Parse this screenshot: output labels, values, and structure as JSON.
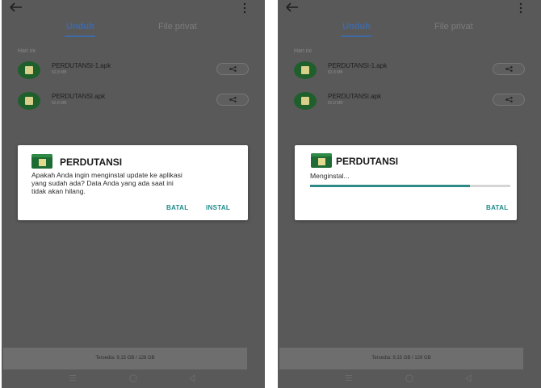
{
  "left": {
    "tabs": [
      "Unduh",
      "File privat"
    ],
    "section_label": "Hari ini",
    "files": [
      {
        "name": "PERDUTANSI-1.apk",
        "size": "82,8 MB"
      },
      {
        "name": "PERDUTANSI.apk",
        "size": "82,8 MB"
      }
    ],
    "dialog": {
      "title": "PERDUTANSI",
      "message_line1": "Apakah Anda ingin menginstal update ke aplikasi",
      "message_line2": "yang sudah ada? Data Anda yang ada saat ini",
      "message_line3": "tidak akan hilang.",
      "cancel_label": "BATAL",
      "install_label": "INSTAL"
    },
    "storage": "Tersedia: 9,15 GB / 128 GB"
  },
  "right": {
    "tabs": [
      "Unduh",
      "File privat"
    ],
    "section_label": "Hari ini",
    "files": [
      {
        "name": "PERDUTANSI-1.apk",
        "size": "82,8 MB"
      },
      {
        "name": "PERDUTANSI.apk",
        "size": "82,8 MB"
      }
    ],
    "dialog": {
      "title": "PERDUTANSI",
      "status": "Menginstal...",
      "progress": 0.8,
      "cancel_label": "BATAL"
    },
    "storage": "Tersedia: 9,15 GB / 128 GB"
  },
  "colors": {
    "overlay": "#595959",
    "accent": "#3f6aa8",
    "button": "#1b8a8a",
    "progress": "#2d8a86",
    "app_icon": "#1f6b35"
  },
  "icons": [
    "back-arrow-icon",
    "more-vert-icon",
    "share-icon",
    "app-icon",
    "nav-menu-icon",
    "nav-home-icon",
    "nav-back-icon"
  ]
}
